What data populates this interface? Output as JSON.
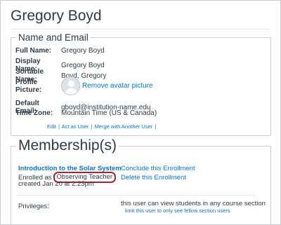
{
  "user": {
    "name": "Gregory Boyd"
  },
  "name_email": {
    "legend": "Name and Email",
    "fields": [
      {
        "label": "Full Name:",
        "value": "Gregory Boyd"
      },
      {
        "label": "Display Name:",
        "value": "Gregory Boyd"
      },
      {
        "label": "Sortable Name:",
        "value": "Boyd, Gregory"
      },
      {
        "label": "Profile Picture:",
        "value": "Remove avatar picture"
      },
      {
        "label": "Default Email:",
        "value": "gboyd@institution-name.edu"
      },
      {
        "label": "Time Zone:",
        "value": "Mountain Time (US & Canada)"
      }
    ],
    "actions": [
      "Edit",
      "Act as User",
      "Merge with Another User"
    ],
    "separator": "|"
  },
  "membership": {
    "legend": "Membership(s)",
    "course": "Introduction to the Solar System",
    "enrolled_prefix": "Enrolled as",
    "role": "Observing Teacher",
    "created": "created Jan 20 at 2:23pm",
    "conclude": "Conclude this Enrollment",
    "delete": "Delete this Enrollment",
    "privileges_label": "Privileges:",
    "privileges_value": "this user can view students in any course section",
    "privileges_link": "limit this user to only see fellow section users"
  },
  "colors": {
    "link": "#0077cc",
    "highlight_border": "#b4202a",
    "text": "#2d3b45"
  }
}
